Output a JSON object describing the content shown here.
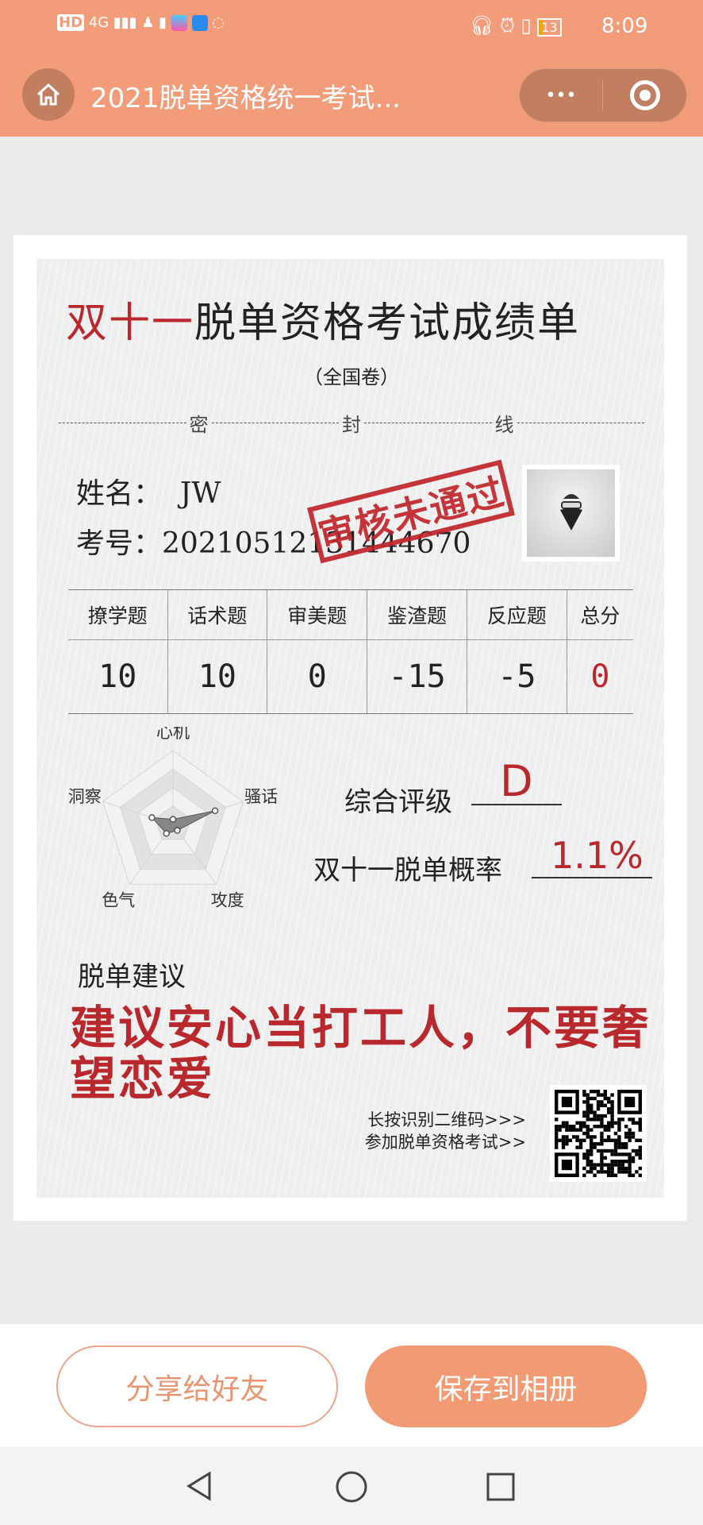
{
  "status_bar": {
    "left_icons": [
      "hd-icon",
      "4g-signal-icon",
      "qq-icon",
      "battery-alert-icon",
      "app-icon",
      "dingtalk-icon",
      "wifi-icon"
    ],
    "network": "4G",
    "battery": "13",
    "time": "8:09"
  },
  "nav": {
    "title": "2021脱单资格统一考试...",
    "more_label": "•••"
  },
  "paper": {
    "title_red": "双十一",
    "title_rest": "脱单资格考试成绩单",
    "subtitle": "（全国卷）",
    "seal": [
      "密",
      "封",
      "线"
    ],
    "name_label": "姓名：",
    "name_value": "JW",
    "id_label": "考号：",
    "id_value": "20210512131444670",
    "stamp": "审核未通过",
    "scores": {
      "headers": [
        "撩学题",
        "话术题",
        "审美题",
        "鉴渣题",
        "反应题",
        "总分"
      ],
      "values": [
        "10",
        "10",
        "0",
        "-15",
        "-5",
        "0"
      ]
    },
    "rating_label": "综合评级",
    "rating_value": "D",
    "prob_label": "双十一脱单概率",
    "prob_value": "1.1%",
    "advice_label": "脱单建议",
    "advice_text": "建议安心当打工人，不要奢望恋爱",
    "qr_line1": "长按识别二维码>>>",
    "qr_line2": "参加脱单资格考试>>"
  },
  "chart_data": {
    "type": "radar",
    "axes": [
      "心机",
      "骚话",
      "攻度",
      "色气",
      "洞察"
    ],
    "values": [
      0.07,
      0.6,
      0.1,
      0.15,
      0.3
    ],
    "range": [
      0,
      1
    ],
    "rings": 4
  },
  "actions": {
    "share": "分享给好友",
    "save": "保存到相册"
  },
  "colors": {
    "accent": "#f29c79",
    "red": "#b9282c"
  }
}
